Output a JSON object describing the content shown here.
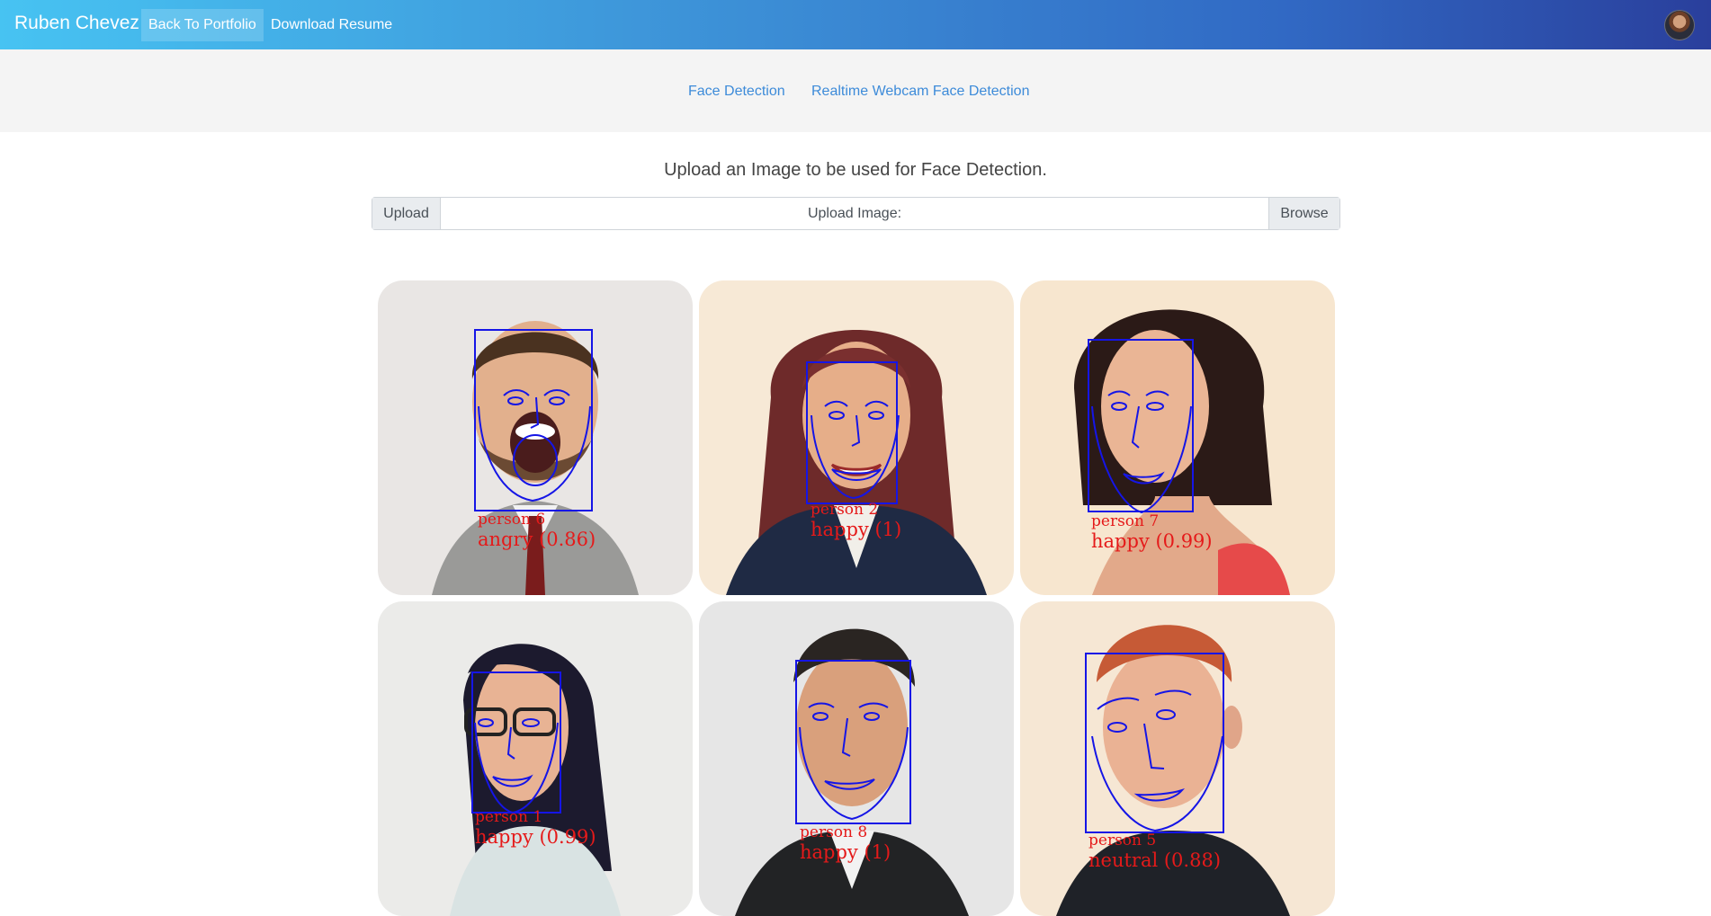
{
  "navbar": {
    "brand": "Ruben Chevez",
    "links": [
      "Back To Portfolio",
      "Download Resume"
    ],
    "colors": {
      "gradient_start": "#47c3f2",
      "gradient_end": "#2a3f9c"
    }
  },
  "subnav": {
    "tabs": [
      "Face Detection",
      "Realtime Webcam Face Detection"
    ],
    "link_color": "#3d8bd9"
  },
  "main": {
    "heading": "Upload an Image to be used for Face Detection.",
    "upload": {
      "upload_button": "Upload",
      "label": "Upload Image:",
      "browse_button": "Browse"
    }
  },
  "detections": [
    {
      "person": "person 6",
      "emotion": "angry (0.86)",
      "bg": "#e9e6e4"
    },
    {
      "person": "person 2",
      "emotion": "happy (1)",
      "bg": "#f7e9d6"
    },
    {
      "person": "person 7",
      "emotion": "happy (0.99)",
      "bg": "#f7e6cf"
    },
    {
      "person": "person 1",
      "emotion": "happy (0.99)",
      "bg": "#ebebe9"
    },
    {
      "person": "person 8",
      "emotion": "happy (1)",
      "bg": "#e6e6e6"
    },
    {
      "person": "person 5",
      "emotion": "neutral (0.88)",
      "bg": "#f6e7d4"
    }
  ],
  "box_color": "#1515e6",
  "label_color": "#e51a1a"
}
